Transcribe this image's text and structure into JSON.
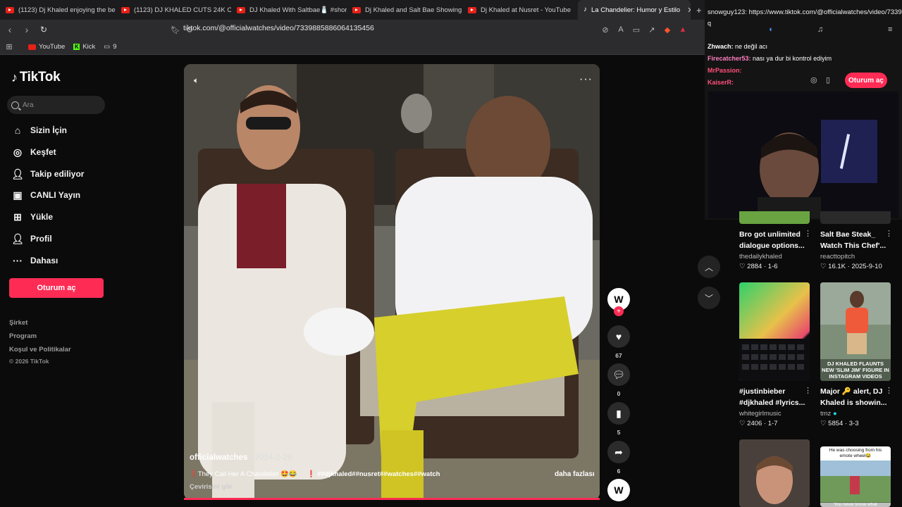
{
  "browser": {
    "tabs": [
      {
        "title": "(1123) Dj Khaled enjoying the beauti",
        "icon": "youtube-icon"
      },
      {
        "title": "(1123) DJ KHALED CUTS 24K CARAT",
        "icon": "youtube-icon"
      },
      {
        "title": "DJ Khaled With Saltbae🧂 #shorts #",
        "icon": "youtube-icon"
      },
      {
        "title": "Dj Khaled and Salt Bae Showing Off",
        "icon": "youtube-icon"
      },
      {
        "title": "Dj Khaled at Nusret - YouTube",
        "icon": "youtube-icon"
      },
      {
        "title": "La Chandelier: Humor y Estilo",
        "icon": "tiktok-icon",
        "active": true
      }
    ],
    "url": "tiktok.com/@officialwatches/video/7339885886064135456",
    "bookmarks": [
      {
        "label": "YouTube",
        "icon": "youtube-icon"
      },
      {
        "label": "Kick",
        "icon": "kick-icon"
      },
      {
        "label": "9",
        "icon": "folder-icon"
      }
    ]
  },
  "sidebar": {
    "logo": "TikTok",
    "search_placeholder": "Ara",
    "items": [
      {
        "label": "Sizin İçin",
        "icon": "home-icon"
      },
      {
        "label": "Keşfet",
        "icon": "compass-icon"
      },
      {
        "label": "Takip ediliyor",
        "icon": "following-icon"
      },
      {
        "label": "CANLI Yayın",
        "icon": "live-icon"
      },
      {
        "label": "Yükle",
        "icon": "upload-icon"
      },
      {
        "label": "Profil",
        "icon": "profile-icon"
      },
      {
        "label": "Dahası",
        "icon": "more-icon"
      }
    ],
    "login_label": "Oturum aç",
    "footer": [
      "Şirket",
      "Program",
      "Koşul ve Politikalar"
    ],
    "copyright": "© 2026 TikTok"
  },
  "video": {
    "author": "officialwatches",
    "date": "2024-2-26",
    "caption": "❗They Call Her A Chandelier 🤩😂",
    "hashtags": "❗ ##djkhaled##nusret##watches##watch",
    "translate": "Çevirisini gör",
    "more": "daha fazlası",
    "likes": "67",
    "comments": "0",
    "saves": "5",
    "shares": "6"
  },
  "overlay": {
    "url_line": "snowguy123: https://www.tiktok.com/@officialwatches/video/7339",
    "url_line2": "q",
    "chat": [
      {
        "user": "Zhwach:",
        "msg": " ne değil acı",
        "color": "#ffffff"
      },
      {
        "user": "Firecatcher53:",
        "msg": " nası ya dur bi kontrol ediyim",
        "color": "#ff7fbf"
      },
      {
        "user": "MrPassion:",
        "msg": "",
        "color": "#ff4f7a"
      },
      {
        "user": "KaiserR:",
        "msg": "",
        "color": "#ff4f7a"
      }
    ],
    "login_label": "Oturum aç"
  },
  "recommended": [
    {
      "title": "Bro got unlimited dialogue options...",
      "user": "thedailykhaled",
      "likes": "2884",
      "date": "1-6"
    },
    {
      "title": "Salt Bae Steak_ Watch This Chef'...",
      "user": "reacttopitch",
      "likes": "16.1K",
      "date": "2025-9-10"
    },
    {
      "title": "#justinbieber #djkhaled #lyrics...",
      "user": "whitegirlmusic",
      "likes": "2406",
      "date": "1-7"
    },
    {
      "title": "Major 🔑 alert, DJ Khaled is showin...",
      "user": "tmz",
      "likes": "5854",
      "date": "3-3"
    }
  ],
  "thumb_text": {
    "tmz": "DJ KHALED FLAUNTS NEW 'SLIM JIM' FIGURE IN INSTAGRAM VIDEOS",
    "bottom_right_top": "He was choosing from his emote wheel😂",
    "bottom_right_bottom": "You never know what"
  }
}
